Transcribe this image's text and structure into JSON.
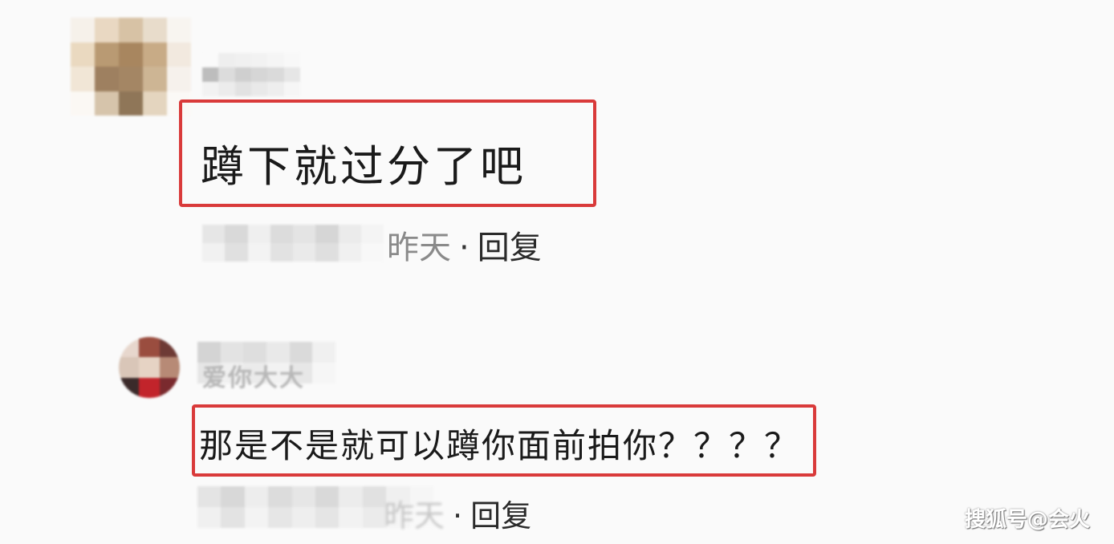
{
  "comments": [
    {
      "text": "蹲下就过分了吧",
      "time": "昨天",
      "separator": "·",
      "reply_label": "回复"
    },
    {
      "author_fragment": "爱你大大",
      "text": "那是不是就可以蹲你面前拍你？？？？",
      "time": "昨天",
      "separator": "·",
      "reply_label": "回复"
    }
  ],
  "watermark": "搜狐号@会火",
  "colors": {
    "highlight_border": "#d93a3a",
    "background": "#fafafa",
    "text": "#1a1a1a"
  }
}
